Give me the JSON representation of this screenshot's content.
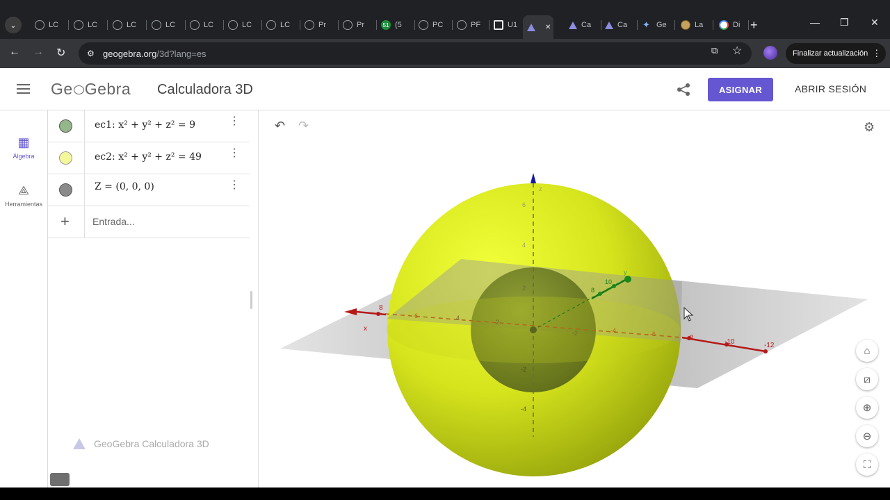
{
  "browser": {
    "tabs": [
      {
        "label": "LC",
        "icon": "globe"
      },
      {
        "label": "LC",
        "icon": "globe"
      },
      {
        "label": "LC",
        "icon": "globe"
      },
      {
        "label": "LC",
        "icon": "globe"
      },
      {
        "label": "LC",
        "icon": "globe"
      },
      {
        "label": "LC",
        "icon": "globe"
      },
      {
        "label": "LC",
        "icon": "globe"
      },
      {
        "label": "Pr",
        "icon": "globe"
      },
      {
        "label": "Pr",
        "icon": "globe"
      },
      {
        "label": "(5",
        "icon": "whatsapp",
        "badge": "51"
      },
      {
        "label": "PC",
        "icon": "globe"
      },
      {
        "label": "PF",
        "icon": "globe"
      },
      {
        "label": "U1",
        "icon": "utp"
      },
      {
        "label": "",
        "icon": "geogebra",
        "active": true
      },
      {
        "label": "Ca",
        "icon": "geogebra"
      },
      {
        "label": "Ca",
        "icon": "geogebra"
      },
      {
        "label": "Ge",
        "icon": "gemini"
      },
      {
        "label": "La",
        "icon": "la"
      },
      {
        "label": "Di",
        "icon": "google"
      }
    ],
    "url_host": "geogebra.org",
    "url_path": "/3d?lang=es",
    "update_label": "Finalizar actualización"
  },
  "header": {
    "logo": "GeoGebra",
    "title": "Calculadora 3D",
    "assign_label": "ASIGNAR",
    "login_label": "ABRIR SESIÓN"
  },
  "sidebar": {
    "algebra_label": "Álgebra",
    "tools_label": "Herramientas"
  },
  "algebra": {
    "rows": [
      {
        "name": "ec1",
        "color": "#93b68a",
        "expr": "ec1: x² + y² + z² = 9"
      },
      {
        "name": "ec2",
        "color": "#f4f79a",
        "expr": "ec2: x² + y² + z² = 49"
      },
      {
        "name": "Z",
        "color": "#8a8a8a",
        "expr": "Z = (0, 0, 0)"
      }
    ],
    "input_placeholder": "Entrada...",
    "footer_label": "GeoGebra Calculadora 3D"
  },
  "view3d": {
    "x_ticks": [
      "8",
      "6",
      "4",
      "2",
      "-2",
      "-4",
      "-6",
      "-8",
      "-10",
      "-12"
    ],
    "x_label": "x",
    "z_ticks": [
      "6",
      "4",
      "2",
      "-2",
      "-4"
    ],
    "z_label": "z",
    "y_ticks": [
      "10",
      "8"
    ],
    "y_label": "y",
    "colors": {
      "outer_sphere": "#d9e81a",
      "inner_sphere": "#6e7d24",
      "x_axis": "#b51a1a",
      "y_axis": "#1a7a1a",
      "z_axis": "#1a1a9a"
    }
  }
}
